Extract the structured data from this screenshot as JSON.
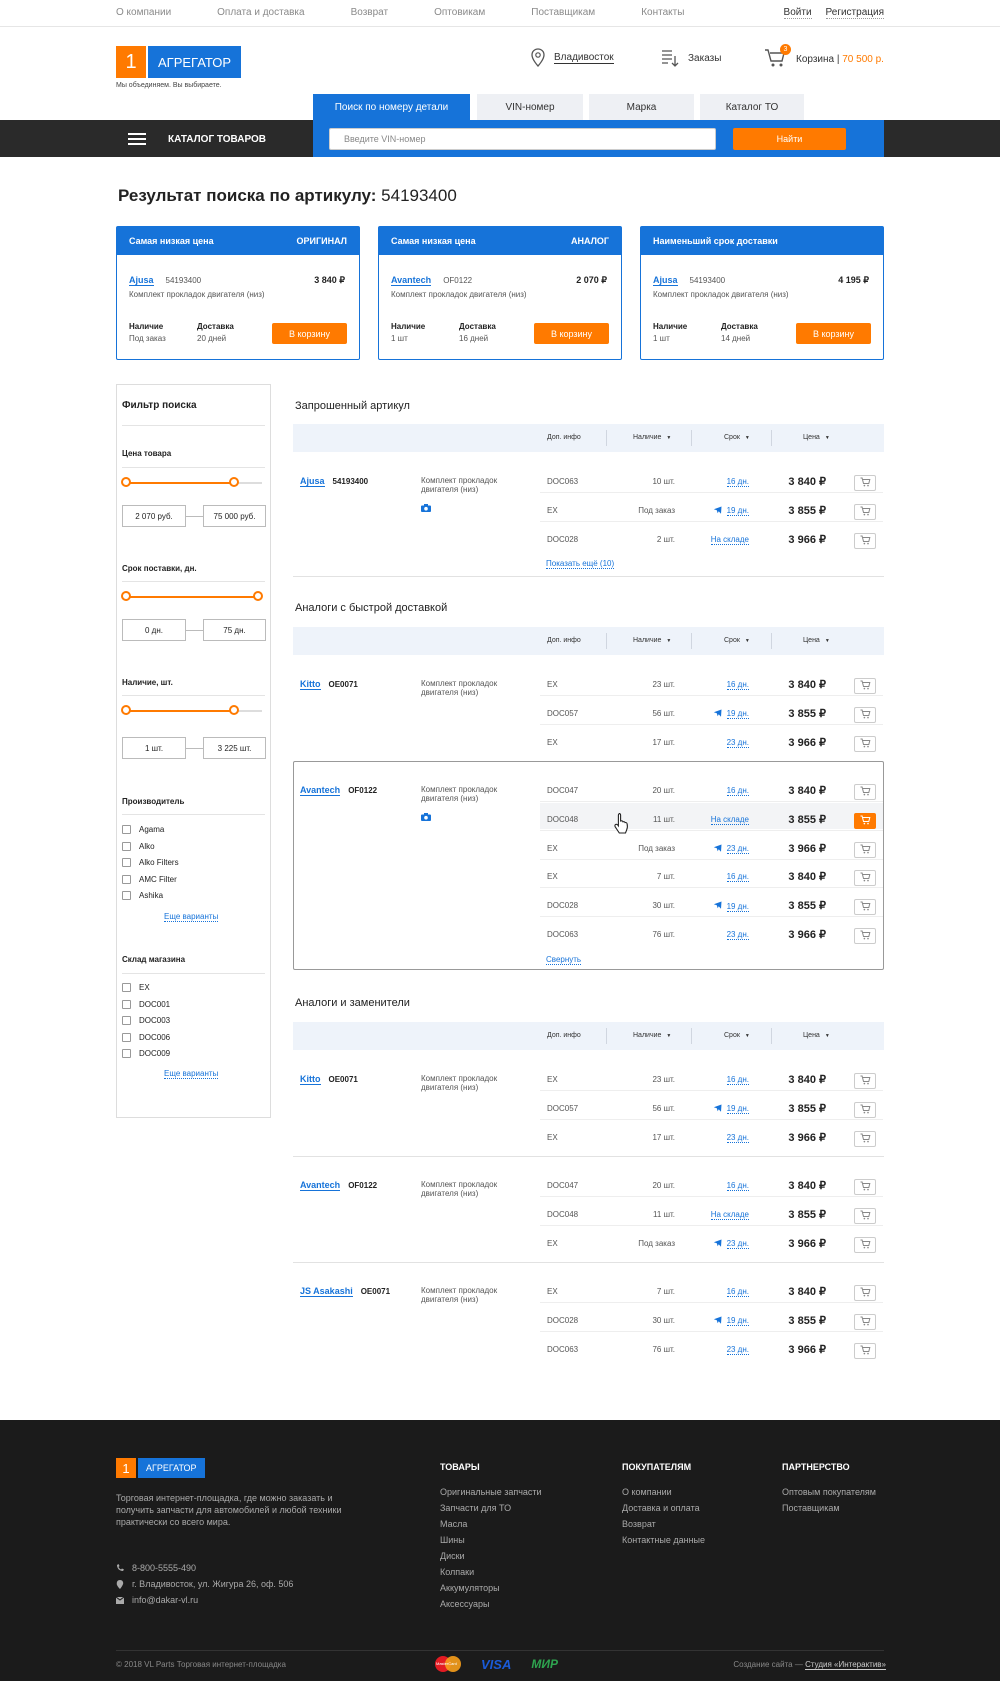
{
  "top_links": [
    "О компании",
    "Оплата и доставка",
    "Возврат",
    "Оптовикам",
    "Поставщикам",
    "Контакты"
  ],
  "auth": {
    "login": "Войти",
    "register": "Регистрация"
  },
  "logo": {
    "digit": "1",
    "name": "АГРЕГАТОР",
    "slogan": "Мы объединяем. Вы выбираете."
  },
  "header": {
    "city": "Владивосток",
    "orders": "Заказы",
    "cart_label": "Корзина",
    "cart_sep": " | ",
    "cart_sum": "70 500 р.",
    "cart_count": "3"
  },
  "nav": {
    "catalog": "КАТАЛОГ ТОВАРОВ"
  },
  "search": {
    "tabs": [
      "Поиск по номеру детали",
      "VIN-номер",
      "Марка",
      "Каталог ТО"
    ],
    "placeholder": "Введите VIN-номер",
    "button": "Найти"
  },
  "page_title": {
    "prefix": "Результат поиска по артикулу: ",
    "article": "54193400"
  },
  "cards": [
    {
      "head": "Самая низкая цена",
      "tag": "ОРИГИНАЛ",
      "brand": "Ajusa",
      "sku": "54193400",
      "price": "3 840 ₽",
      "desc": "Комплект прокладок двигателя (низ)",
      "avail_label": "Наличие",
      "avail": "Под заказ",
      "deliv_label": "Доставка",
      "deliv": "20 дней",
      "btn": "В корзину"
    },
    {
      "head": "Самая низкая цена",
      "tag": "АНАЛОГ",
      "brand": "Avantech",
      "sku": "OF0122",
      "price": "2 070 ₽",
      "desc": "Комплект прокладок двигателя (низ)",
      "avail_label": "Наличие",
      "avail": "1 шт",
      "deliv_label": "Доставка",
      "deliv": "16 дней",
      "btn": "В корзину"
    },
    {
      "head": "Наименьший срок доставки",
      "tag": "",
      "brand": "Ajusa",
      "sku": "54193400",
      "price": "4 195 ₽",
      "desc": "Комплект прокладок двигателя (низ)",
      "avail_label": "Наличие",
      "avail": "1 шт",
      "deliv_label": "Доставка",
      "deliv": "14 дней",
      "btn": "В корзину"
    }
  ],
  "filter": {
    "title": "Фильтр поиска",
    "price": {
      "label": "Цена товара",
      "from": "2 070 руб.",
      "to": "75 000 руб."
    },
    "term": {
      "label": "Срок поставки, дн.",
      "from": "0 дн.",
      "to": "75 дн."
    },
    "stock": {
      "label": "Наличие, шт.",
      "from": "1 шт.",
      "to": "3 225 шт."
    },
    "makers": {
      "label": "Производитель",
      "items": [
        "Agama",
        "Alko",
        "Alko Filters",
        "AMC Filter",
        "Ashika"
      ],
      "more": "Еще варианты"
    },
    "stores": {
      "label": "Склад магазина",
      "items": [
        "EX",
        "DOC001",
        "DOC003",
        "DOC006",
        "DOC009"
      ],
      "more": "Еще варианты"
    }
  },
  "table_head": {
    "info": "Доп. инфо",
    "stock": "Наличие",
    "term": "Срок",
    "price": "Цена"
  },
  "sections": [
    {
      "title": "Запрошенный артикул",
      "groups": [
        {
          "brand": "Ajusa",
          "sku": "54193400",
          "desc": "Комплект прокладок двигателя (низ)",
          "photo": true,
          "rows": [
            {
              "info": "DOC063",
              "stock": "10 шт.",
              "term": "16 дн.",
              "air": false,
              "price": "3 840 ₽"
            },
            {
              "info": "EX",
              "stock": "Под заказ",
              "term": "19 дн.",
              "air": true,
              "price": "3 855 ₽"
            },
            {
              "info": "DOC028",
              "stock": "2 шт.",
              "term": "На складе",
              "air": false,
              "price": "3 966 ₽"
            }
          ],
          "more": "Показать ещё (10)"
        }
      ]
    },
    {
      "title": "Аналоги с быстрой доставкой",
      "groups": [
        {
          "brand": "Kitto",
          "sku": "OE0071",
          "desc": "Комплект прокладок двигателя (низ)",
          "photo": false,
          "rows": [
            {
              "info": "EX",
              "stock": "23 шт.",
              "term": "16 дн.",
              "air": false,
              "price": "3 840 ₽"
            },
            {
              "info": "DOC057",
              "stock": "56 шт.",
              "term": "19 дн.",
              "air": true,
              "price": "3 855 ₽"
            },
            {
              "info": "EX",
              "stock": "17 шт.",
              "term": "23 дн.",
              "air": false,
              "price": "3 966 ₽"
            }
          ]
        },
        {
          "brand": "Avantech",
          "sku": "OF0122",
          "desc": "Комплект прокладок двигателя (низ)",
          "photo": true,
          "rows": [
            {
              "info": "DOC047",
              "stock": "20 шт.",
              "term": "16 дн.",
              "air": false,
              "price": "3 840 ₽"
            },
            {
              "info": "DOC048",
              "stock": "11 шт.",
              "term": "На складе",
              "air": false,
              "price": "3 855 ₽"
            },
            {
              "info": "EX",
              "stock": "Под заказ",
              "term": "23 дн.",
              "air": true,
              "price": "3 966 ₽"
            },
            {
              "info": "EX",
              "stock": "7 шт.",
              "term": "16 дн.",
              "air": false,
              "price": "3 840 ₽"
            },
            {
              "info": "DOC028",
              "stock": "30 шт.",
              "term": "19 дн.",
              "air": true,
              "price": "3 855 ₽"
            },
            {
              "info": "DOC063",
              "stock": "76 шт.",
              "term": "23 дн.",
              "air": false,
              "price": "3 966 ₽"
            }
          ],
          "more": "Свернуть"
        }
      ]
    },
    {
      "title": "Аналоги и заменители",
      "groups": [
        {
          "brand": "Kitto",
          "sku": "OE0071",
          "desc": "Комплект прокладок двигателя (низ)",
          "photo": false,
          "rows": [
            {
              "info": "EX",
              "stock": "23 шт.",
              "term": "16 дн.",
              "air": false,
              "price": "3 840 ₽"
            },
            {
              "info": "DOC057",
              "stock": "56 шт.",
              "term": "19 дн.",
              "air": true,
              "price": "3 855 ₽"
            },
            {
              "info": "EX",
              "stock": "17 шт.",
              "term": "23 дн.",
              "air": false,
              "price": "3 966 ₽"
            }
          ]
        },
        {
          "brand": "Avantech",
          "sku": "OF0122",
          "desc": "Комплект прокладок двигателя (низ)",
          "photo": false,
          "rows": [
            {
              "info": "DOC047",
              "stock": "20 шт.",
              "term": "16 дн.",
              "air": false,
              "price": "3 840 ₽"
            },
            {
              "info": "DOC048",
              "stock": "11 шт.",
              "term": "На складе",
              "air": false,
              "price": "3 855 ₽"
            },
            {
              "info": "EX",
              "stock": "Под заказ",
              "term": "23 дн.",
              "air": true,
              "price": "3 966 ₽"
            }
          ]
        },
        {
          "brand": "JS Asakashi",
          "sku": "OE0071",
          "desc": "Комплект прокладок двигателя (низ)",
          "photo": false,
          "rows": [
            {
              "info": "EX",
              "stock": "7 шт.",
              "term": "16 дн.",
              "air": false,
              "price": "3 840 ₽"
            },
            {
              "info": "DOC028",
              "stock": "30 шт.",
              "term": "19 дн.",
              "air": true,
              "price": "3 855 ₽"
            },
            {
              "info": "DOC063",
              "stock": "76 шт.",
              "term": "23 дн.",
              "air": false,
              "price": "3 966 ₽"
            }
          ]
        }
      ]
    }
  ],
  "footer": {
    "about": "Торговая интернет-площадка, где можно заказать и получить запчасти для автомобилей и любой техники практически со всего мира.",
    "phone": "8-800-5555-490",
    "address": "г. Владивосток, ул. Жигура 26, оф. 506",
    "email": "info@dakar-vl.ru",
    "cols": [
      {
        "title": "ТОВАРЫ",
        "links": [
          "Оригинальные запчасти",
          "Запчасти для ТО",
          "Масла",
          "Шины",
          "Диски",
          "Колпаки",
          "Аккумуляторы",
          "Аксессуары"
        ]
      },
      {
        "title": "ПОКУПАТЕЛЯМ",
        "links": [
          "О компании",
          "Доставка и оплата",
          "Возврат",
          "Контактные данные"
        ]
      },
      {
        "title": "ПАРТНЕРСТВО",
        "links": [
          "Оптовым покупателям",
          "Поставщикам"
        ]
      }
    ],
    "copyright": "© 2018 VL Parts Торговая интернет-площадка",
    "pay": [
      "MasterCard",
      "VISA",
      "МИР"
    ],
    "credit_prefix": "Создание сайта — ",
    "credit_link": "Студия «Интерактив»"
  },
  "colors": {
    "accent": "#1673d9",
    "orange": "#ff7a00",
    "dark": "#2a2a2a"
  }
}
